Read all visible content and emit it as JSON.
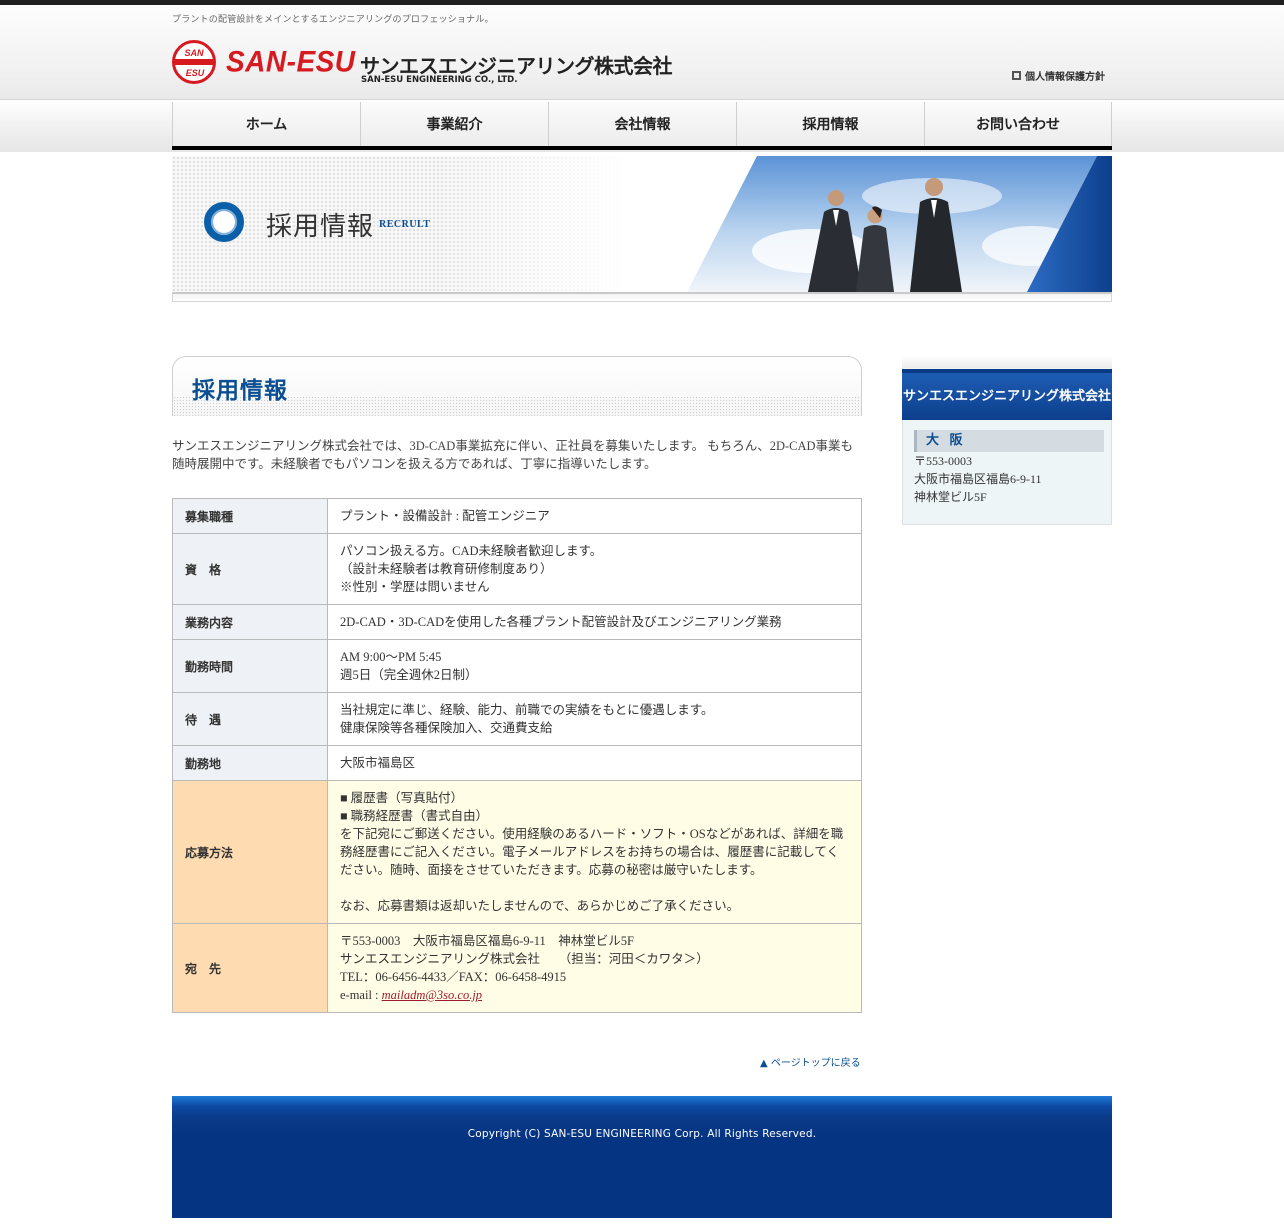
{
  "header": {
    "tagline": "プラントの配管設計をメインとするエンジニアリングのプロフェッショナル。",
    "logo_mark_top": "SAN",
    "logo_mark_bottom": "ESU",
    "logo_word": "SAN-ESU",
    "company_jp": "サンエスエンジニアリング株式会社",
    "company_en": "SAN-ESU ENGINEERING CO., LTD.",
    "privacy_link": "個人情報保護方針"
  },
  "nav": {
    "items": [
      "ホーム",
      "事業紹介",
      "会社情報",
      "採用情報",
      "お問い合わせ"
    ]
  },
  "hero": {
    "title": "採用情報",
    "subtitle": "RECRULT"
  },
  "main": {
    "title": "採用情報",
    "intro": "サンエスエンジニアリング株式会社では、3D-CAD事業拡充に伴い、正社員を募集いたします。 もちろん、2D-CAD事業も随時展開中です。未経験者でもパソコンを扱える方であれば、丁寧に指導いたします。",
    "rows": [
      {
        "label": "募集職種",
        "lines": [
          "プラント・設備設計 : 配管エンジニア"
        ]
      },
      {
        "label": "資　格",
        "lines": [
          "パソコン扱える方。CAD未経験者歓迎します。",
          "（設計未経験者は教育研修制度あり）",
          "※性別・学歴は問いません"
        ]
      },
      {
        "label": "業務内容",
        "lines": [
          "2D-CAD・3D-CADを使用した各種プラント配管設計及びエンジニアリング業務"
        ]
      },
      {
        "label": "勤務時間",
        "lines": [
          "AM 9:00～PM 5:45",
          "週5日（完全週休2日制）"
        ]
      },
      {
        "label": "待　遇",
        "lines": [
          "当社規定に準じ、経験、能力、前職での実績をもとに優遇します。",
          "健康保険等各種保険加入、交通費支給"
        ]
      },
      {
        "label": "勤務地",
        "lines": [
          "大阪市福島区"
        ]
      },
      {
        "label": "応募方法",
        "lines": [
          "■ 履歴書（写真貼付）",
          "■ 職務経歴書（書式自由）",
          "を下記宛にご郵送ください。使用経験のあるハード・ソフト・OSなどがあれば、詳細を職務経歴書にご記入ください。電子メールアドレスをお持ちの場合は、履歴書に記載してください。随時、面接をさせていただきます。応募の秘密は厳守いたします。",
          "",
          "なお、応募書類は返却いたしませんので、あらかじめご了承ください。"
        ]
      },
      {
        "label": "宛　先",
        "lines": [
          "〒553-0003　大阪市福島区福島6-9-11　神林堂ビル5F",
          "サンエスエンジニアリング株式会社　　（担当：河田＜カワタ＞）",
          "TEL：06-6456-4433／FAX：06-6458-4915"
        ],
        "email_prefix": "e-mail : ",
        "email": "mailadm@3so.co.jp"
      }
    ],
    "page_top": "▲ ページトップに戻る"
  },
  "sidebar": {
    "company": "サンエスエンジニアリング株式会社",
    "city": "大 阪",
    "address_lines": [
      "〒553-0003",
      "大阪市福島区福島6-9-11",
      "神林堂ビル5F"
    ]
  },
  "footer": {
    "copyright": "Copyright (C) SAN-ESU ENGINEERING Corp.  All Rights Reserved."
  },
  "colors": {
    "brand_red": "#d71920",
    "brand_blue": "#0b4f92",
    "footer_blue": "#053482",
    "highlight_label": "#fedbb0",
    "highlight_cell": "#fffde6"
  }
}
